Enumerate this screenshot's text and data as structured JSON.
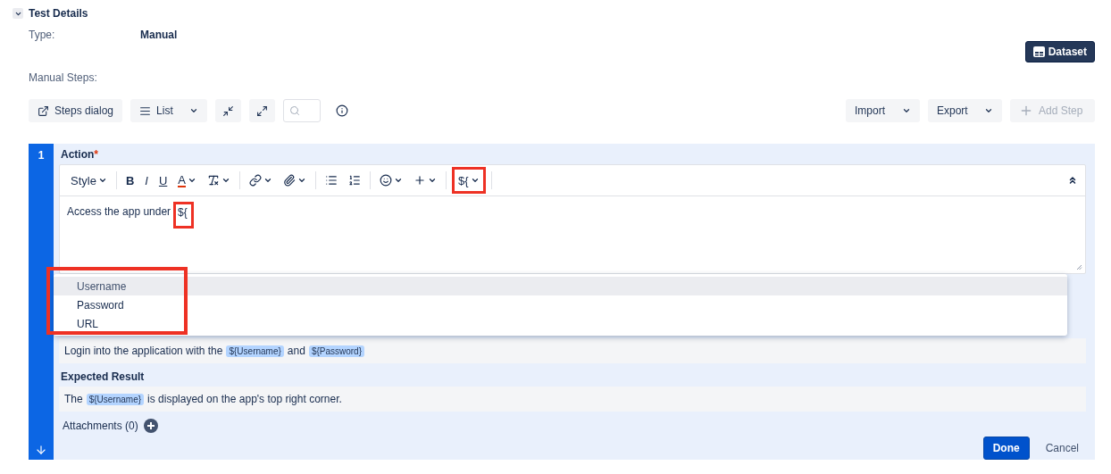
{
  "section": {
    "title": "Test Details",
    "expanded": true
  },
  "fields": [
    {
      "label": "Type:",
      "value": "Manual"
    }
  ],
  "dataset_button": "Dataset",
  "steps_label": "Manual Steps:",
  "toolbar": {
    "steps_dialog": "Steps dialog",
    "view": "List",
    "import": "Import",
    "export": "Export",
    "add_step": {
      "label": "Add Step",
      "disabled": true
    }
  },
  "step": {
    "number": "1",
    "action_label": "Action",
    "required": true,
    "required_mark": "*",
    "editor": {
      "toolbar_groups": [
        [
          {
            "kind": "menu",
            "label": "Style"
          }
        ],
        [
          {
            "kind": "bold",
            "label": "B"
          },
          {
            "kind": "italic",
            "label": "I"
          },
          {
            "kind": "underline",
            "label": "U"
          },
          {
            "kind": "color",
            "label": "A"
          },
          {
            "kind": "clear-format"
          }
        ],
        [
          {
            "kind": "link"
          },
          {
            "kind": "attach"
          }
        ],
        [
          {
            "kind": "bullets"
          },
          {
            "kind": "numbers"
          }
        ],
        [
          {
            "kind": "emoji"
          },
          {
            "kind": "insert"
          }
        ],
        [
          {
            "kind": "variable",
            "label": "${",
            "highlighted": true
          }
        ]
      ],
      "text": "Access the app under",
      "typed": "${",
      "typed_highlighted": true
    },
    "suggestions": {
      "highlighted": true,
      "items": [
        {
          "label": "Username",
          "selected": true
        },
        {
          "label": "Password",
          "selected": false
        },
        {
          "label": "URL",
          "selected": false
        }
      ]
    },
    "data_text": [
      {
        "kind": "text",
        "text": "Login into the application with the"
      },
      {
        "kind": "variable",
        "text": "${Username}"
      },
      {
        "kind": "text",
        "text": "and"
      },
      {
        "kind": "variable",
        "text": "${Password}"
      }
    ],
    "expected_label": "Expected Result",
    "expected_text": [
      {
        "kind": "text",
        "text": "The"
      },
      {
        "kind": "variable",
        "text": "${Username}"
      },
      {
        "kind": "text",
        "text": "is displayed on the app's top right corner."
      }
    ],
    "attachments": "Attachments (0)",
    "done": "Done",
    "cancel": "Cancel"
  }
}
